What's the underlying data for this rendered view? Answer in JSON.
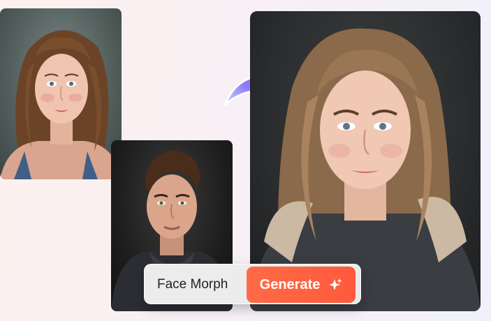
{
  "images": {
    "source_a": {
      "icon": "portrait-woman-photo"
    },
    "source_b": {
      "icon": "portrait-man-photo"
    },
    "result": {
      "icon": "morphed-portrait-photo"
    }
  },
  "arrow": {
    "icon": "curved-arrow-right-icon",
    "colors": [
      "#6b7bff",
      "#c07cff",
      "#ff5a3c"
    ]
  },
  "action_bar": {
    "mode_label": "Face Morph",
    "generate_label": "Generate",
    "generate_icon": "sparkle-icon",
    "accent": "#ff5a3c"
  }
}
